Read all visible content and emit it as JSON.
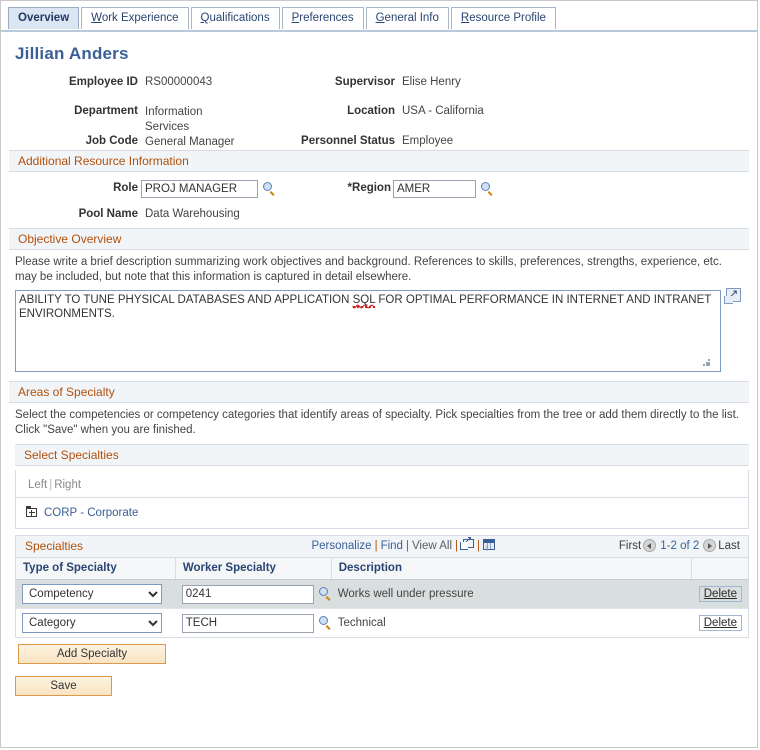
{
  "tabs": [
    {
      "label": "Overview",
      "accesskey": "",
      "active": true
    },
    {
      "label": "Work Experience",
      "accesskey": "W",
      "active": false
    },
    {
      "label": "Qualifications",
      "accesskey": "Q",
      "active": false
    },
    {
      "label": "Preferences",
      "accesskey": "P",
      "active": false
    },
    {
      "label": "General Info",
      "accesskey": "G",
      "active": false
    },
    {
      "label": "Resource Profile",
      "accesskey": "R",
      "active": false
    }
  ],
  "page_title": "Jillian Anders",
  "employee_info": {
    "employee_id_label": "Employee ID",
    "employee_id_value": "RS00000043",
    "department_label": "Department",
    "department_value": "Information Services",
    "job_code_label": "Job Code",
    "job_code_value": "General Manager",
    "supervisor_label": "Supervisor",
    "supervisor_value": "Elise Henry",
    "location_label": "Location",
    "location_value": "USA - California",
    "personnel_status_label": "Personnel Status",
    "personnel_status_value": "Employee"
  },
  "additional_resource": {
    "section_title": "Additional Resource Information",
    "role_label": "Role",
    "role_value": "PROJ MANAGER",
    "region_label": "Region",
    "region_required_marker": "*",
    "region_value": "AMER",
    "pool_name_label": "Pool Name",
    "pool_name_value": "Data Warehousing"
  },
  "objective_overview": {
    "section_title": "Objective Overview",
    "instructions": "Please write a brief description summarizing work objectives and background. References to skills, preferences, strengths, experience, etc. may be included, but note that this information is captured in detail elsewhere.",
    "text_part1": "ABILITY TO TUNE PHYSICAL DATABASES AND APPLICATION ",
    "text_misspelled": "SQL",
    "text_part2": " FOR OPTIMAL PERFORMANCE IN INTERNET AND INTRANET ENVIRONMENTS."
  },
  "areas_of_specialty": {
    "section_title": "Areas of Specialty",
    "instructions": "Select the competencies or competency categories that identify areas of specialty. Pick specialties from the tree or add them directly to the list. Click \"Save\" when you are finished.",
    "select_specialties_title": "Select Specialties",
    "left_label": "Left",
    "right_label": "Right",
    "tree_node_label": "CORP - Corporate"
  },
  "specialties_grid": {
    "title": "Specialties",
    "personalize_label": "Personalize",
    "find_label": "Find",
    "view_all_label": "View All",
    "first_label": "First",
    "last_label": "Last",
    "range_label": "1-2 of 2",
    "columns": [
      "Type of Specialty",
      "Worker Specialty",
      "Description",
      ""
    ],
    "rows": [
      {
        "type": "Competency",
        "type_options": [
          "Competency",
          "Category"
        ],
        "worker_specialty": "0241",
        "description": "Works well under pressure",
        "delete_label": "Delete"
      },
      {
        "type": "Category",
        "type_options": [
          "Competency",
          "Category"
        ],
        "worker_specialty": "TECH",
        "description": "Technical",
        "delete_label": "Delete"
      }
    ]
  },
  "buttons": {
    "add_specialty": "Add Specialty",
    "save": "Save"
  },
  "colors": {
    "tab_active_bg": "#dce6f2",
    "section_header_text": "#b1500a",
    "title_text": "#3b6098",
    "link": "#3b6098",
    "button_border": "#d99b4a",
    "row_alt_bg": "#d9dfdf",
    "spellcheck": "#d02020"
  }
}
